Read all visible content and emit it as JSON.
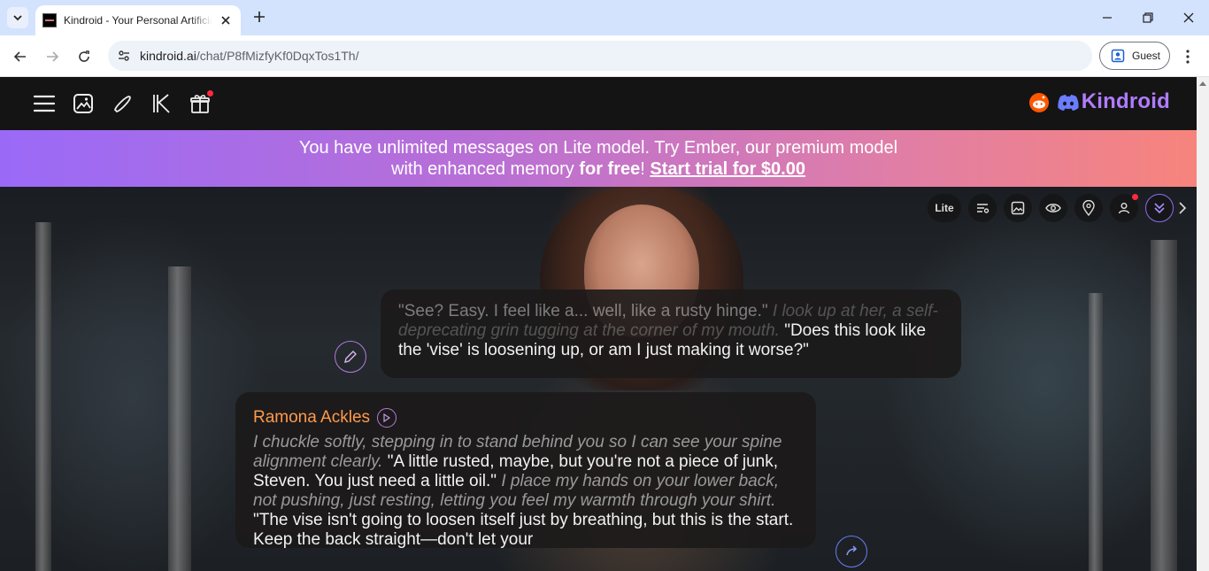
{
  "browser": {
    "tab_title": "Kindroid - Your Personal Artificial Intelligence",
    "url_host": "kindroid.ai",
    "url_path": "/chat/P8fMizfyKf0DqxTos1Th/",
    "profile_label": "Guest"
  },
  "header": {
    "brand": "Kindroid"
  },
  "banner": {
    "line1": "You have unlimited messages on Lite model. Try Ember, our premium model",
    "line2_plain": "with enhanced memory ",
    "line2_bold": "for free",
    "line2_exclaim": "! ",
    "cta": "Start trial for $0.00"
  },
  "controls": {
    "model_badge": "Lite"
  },
  "messages": {
    "user": {
      "quote1": "\"See? Easy. I feel like a... well, like a rusty hinge.\"",
      "action1": "I look up at her, a self-deprecating grin tugging at the corner of my mouth.",
      "quote2": "\"Does this look like the 'vise' is loosening up, or am I just making it worse?\""
    },
    "ai": {
      "name": "Ramona Ackles",
      "action1": "I chuckle softly, stepping in to stand behind you so I can see your spine alignment clearly.",
      "quote1": "\"A little rusted, maybe, but you're not a piece of junk, Steven. You just need a little oil.\"",
      "action2": "I place my hands on your lower back, not pushing, just resting, letting you feel my warmth through your shirt.",
      "quote2": "\"The vise isn't going to loosen itself just by breathing, but this is the start. Keep the back straight—don't let your"
    }
  },
  "colors": {
    "brand": "#b07cff",
    "ai_name": "#ff9a4a",
    "banner_start": "#9a6af7",
    "banner_end": "#f7847c",
    "notification": "#ff2a3b"
  }
}
